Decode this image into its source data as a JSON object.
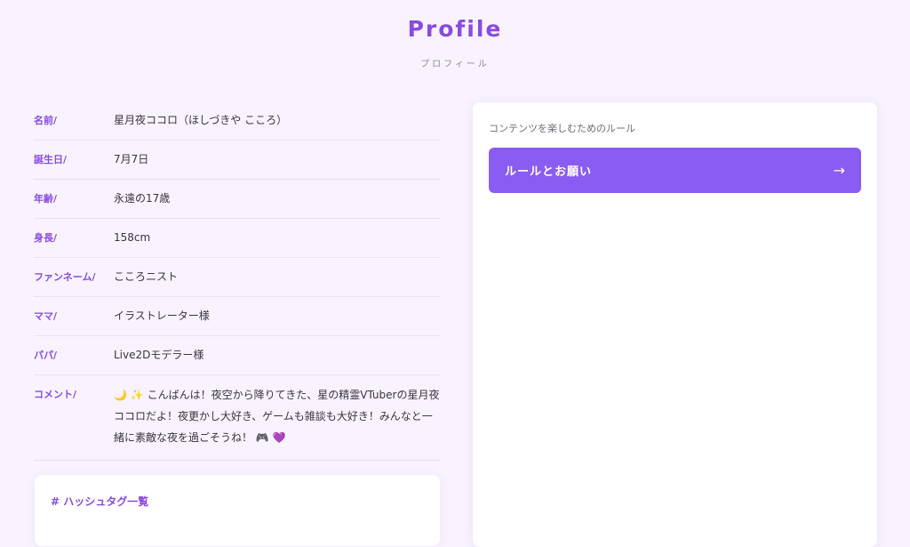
{
  "header": {
    "title": "Profile",
    "subtitle": "プロフィール"
  },
  "profile": {
    "rows": [
      {
        "label": "名前/",
        "value": "星月夜ココロ（ほしづきや こころ）"
      },
      {
        "label": "誕生日/",
        "value": "7月7日"
      },
      {
        "label": "年齢/",
        "value": "永遠の17歳"
      },
      {
        "label": "身長/",
        "value": "158cm"
      },
      {
        "label": "ファンネーム/",
        "value": "こころニスト"
      },
      {
        "label": "ママ/",
        "value": "イラストレーター様"
      },
      {
        "label": "パパ/",
        "value": "Live2Dモデラー様"
      }
    ],
    "comment": {
      "label": "コメント/",
      "emoji_moon": "🌙",
      "emoji_sparkles": "✨",
      "text": "こんばんは！夜空から降りてきた、星の精霊VTuberの星月夜ココロだよ！夜更かし大好き、ゲームも雑談も大好き！みんなと一緒に素敵な夜を過ごそうね！",
      "emoji_gamepad": "🎮",
      "emoji_heart": "💜"
    }
  },
  "hashtags": {
    "title": "# ハッシュタグ一覧"
  },
  "rules": {
    "caption": "コンテンツを楽しむためのルール",
    "button_label": "ルールとお願い",
    "button_arrow": "→"
  },
  "colors": {
    "accent": "#8a4bdf",
    "button": "#8b5cf1",
    "background": "#f8f3fe"
  },
  "icons": {
    "arrow": "arrow-right-icon"
  }
}
